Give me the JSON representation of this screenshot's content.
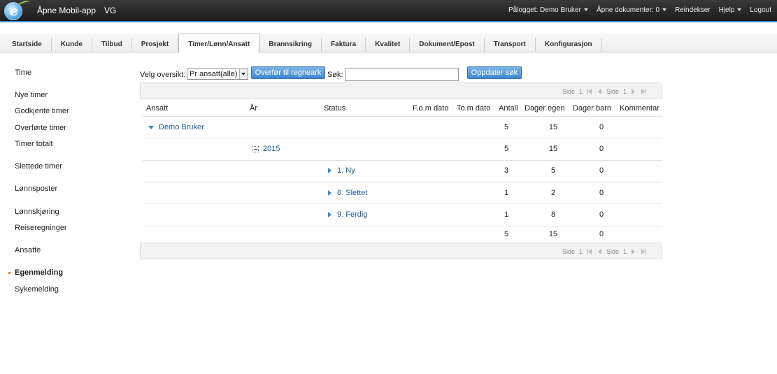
{
  "app": {
    "title": "Åpne Mobil-app",
    "subtitle": "VG"
  },
  "topmenu": {
    "logged_in": "Pålogget: Demo Bruker",
    "open_docs": "Åpne dokumenter: 0",
    "reindex": "Reindekser",
    "help": "Hjelp",
    "logout": "Logout"
  },
  "tabs": [
    "Startside",
    "Kunde",
    "Tilbud",
    "Prosjekt",
    "Timer/Lønn/Ansatt",
    "Brannsikring",
    "Faktura",
    "Kvalitet",
    "Dokument/Epost",
    "Transport",
    "Konfigurasjon"
  ],
  "active_tab": "Timer/Lønn/Ansatt",
  "sidebar": {
    "items": [
      "Time",
      "Nye timer",
      "Godkjente timer",
      "Overførte timer",
      "Timer totalt",
      "Slettede timer",
      "Lønnsposter",
      "Lønnskjøring",
      "Reiseregninger",
      "Ansatte",
      "Egenmelding",
      "Sykemelding"
    ],
    "active": "Egenmelding"
  },
  "controls": {
    "overview_label": "Velg oversikt:",
    "overview_value": "Pr ansatt(alle)",
    "export_button": "Overfør til regneark",
    "search_label": "Søk:",
    "search_value": "",
    "update_button": "Oppdater søk"
  },
  "pager": {
    "side_label": "Side",
    "page": "1",
    "side_label2": "Side",
    "total": "1"
  },
  "columns": [
    "Ansatt",
    "År",
    "Status",
    "F.o.m dato",
    "To.m dato",
    "Antall",
    "Dager egen",
    "Dager barn",
    "Kommentar"
  ],
  "rows": [
    {
      "ansatt": "Demo Bruker",
      "aar": "",
      "status": "",
      "antall": "5",
      "dager_egen": "15",
      "dager_barn": "0"
    },
    {
      "ansatt": "",
      "aar": "2015",
      "status": "",
      "antall": "5",
      "dager_egen": "15",
      "dager_barn": "0"
    },
    {
      "ansatt": "",
      "aar": "",
      "status": "1. Ny",
      "antall": "3",
      "dager_egen": "5",
      "dager_barn": "0"
    },
    {
      "ansatt": "",
      "aar": "",
      "status": "8. Slettet",
      "antall": "1",
      "dager_egen": "2",
      "dager_barn": "0"
    },
    {
      "ansatt": "",
      "aar": "",
      "status": "9. Ferdig",
      "antall": "1",
      "dager_egen": "8",
      "dager_barn": "0"
    }
  ],
  "totals": {
    "antall": "5",
    "dager_egen": "15",
    "dager_barn": "0"
  },
  "colors": {
    "accent": "#3b8fd1",
    "link": "#1a5c98",
    "active_marker": "#e07b1d"
  }
}
